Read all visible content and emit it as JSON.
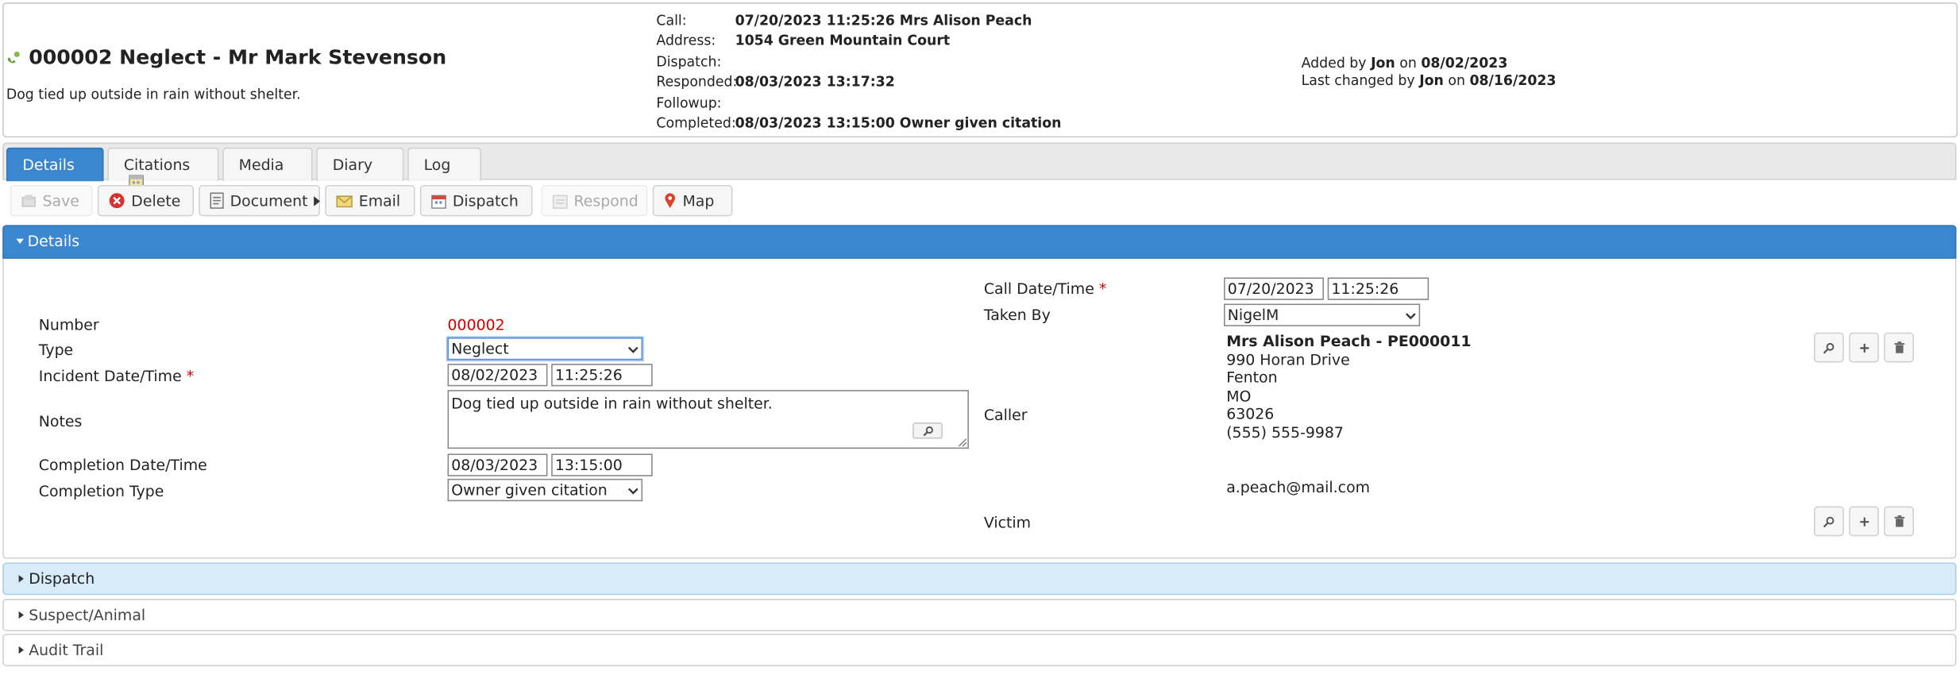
{
  "header": {
    "title": "000002 Neglect - Mr Mark Stevenson",
    "subtitle": "Dog tied up outside in rain without shelter.",
    "call_info": [
      {
        "label": "Call:",
        "value": "07/20/2023 11:25:26 Mrs Alison Peach"
      },
      {
        "label": "Address:",
        "value": "1054 Green Mountain Court"
      },
      {
        "label": "Dispatch:",
        "value": ""
      },
      {
        "label": "Responded:",
        "value": "08/03/2023 13:17:32"
      },
      {
        "label": "Followup:",
        "value": ""
      },
      {
        "label": "Completed:",
        "value": "08/03/2023 13:15:00 Owner given citation"
      }
    ],
    "added_by_prefix": "Added by",
    "added_by_user": "Jon",
    "added_on_word": "on",
    "added_on_date": "08/02/2023",
    "changed_by_prefix": "Last changed by",
    "changed_by_user": "Jon",
    "changed_on_word": "on",
    "changed_on_date": "08/16/2023"
  },
  "tabs": [
    "Details",
    "Citations",
    "Media",
    "Diary",
    "Log"
  ],
  "toolbar": {
    "save": "Save",
    "delete": "Delete",
    "document": "Document",
    "email": "Email",
    "dispatch": "Dispatch",
    "respond": "Respond",
    "map": "Map"
  },
  "details": {
    "section_title": "Details",
    "number_label": "Number",
    "number_value": "000002",
    "type_label": "Type",
    "type_value": "Neglect",
    "incident_label": "Incident Date/Time",
    "incident_date": "08/02/2023",
    "incident_time": "11:25:26",
    "notes_label": "Notes",
    "notes_value": "Dog tied up outside in rain without shelter.",
    "completion_label": "Completion Date/Time",
    "completion_date": "08/03/2023",
    "completion_time": "13:15:00",
    "completion_type_label": "Completion Type",
    "completion_type_value": "Owner given citation",
    "call_label": "Call Date/Time",
    "call_date": "07/20/2023",
    "call_time": "11:25:26",
    "taken_by_label": "Taken By",
    "taken_by_value": "NigelM",
    "caller_label": "Caller",
    "caller_name": "Mrs Alison Peach - PE000011",
    "caller_address1": "990 Horan Drive",
    "caller_city": "Fenton",
    "caller_state": "MO",
    "caller_zip": "63026",
    "caller_phone": "(555) 555-9987",
    "caller_email": "a.peach@mail.com",
    "victim_label": "Victim",
    "required_mark": "*"
  },
  "sections": [
    "Dispatch",
    "Suspect/Animal",
    "Audit Trail"
  ]
}
